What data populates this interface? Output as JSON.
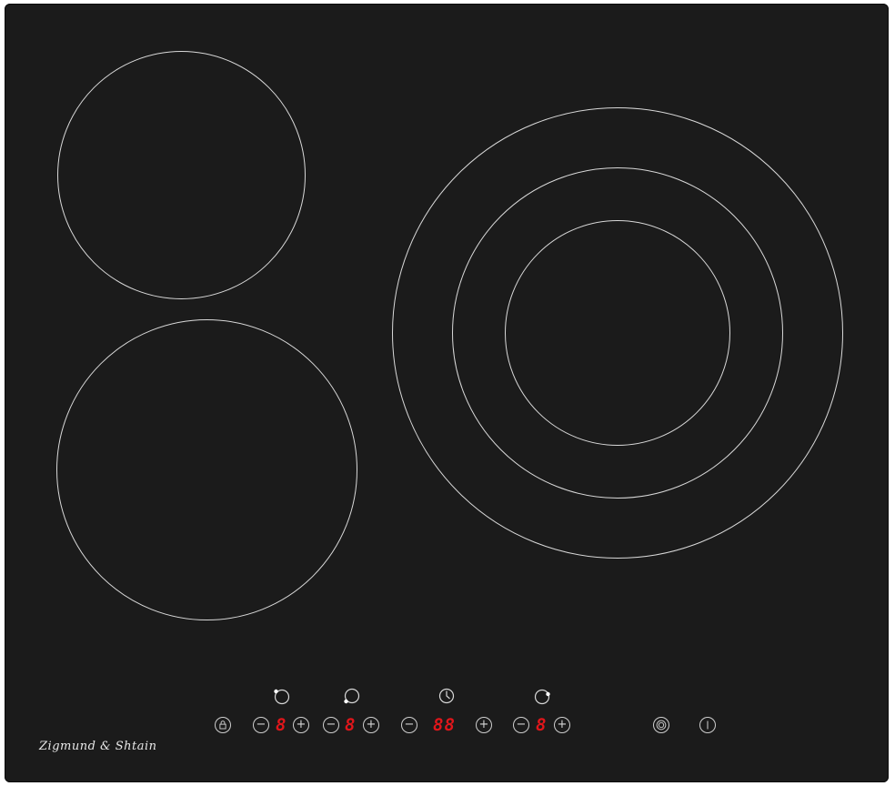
{
  "brand": {
    "name": "Zigmund & Shtain"
  },
  "controls": {
    "lock": {
      "icon": "lock-icon"
    },
    "zone_front_left": {
      "icon": "zone-front-left-icon",
      "minus": "−",
      "level": "8",
      "plus": "+"
    },
    "zone_rear_left": {
      "icon": "zone-rear-left-icon",
      "minus": "−",
      "level": "8",
      "plus": "+"
    },
    "timer": {
      "icon": "clock-icon",
      "minus": "−",
      "display": "88",
      "plus": "+"
    },
    "zone_right": {
      "icon": "zone-right-icon",
      "minus": "−",
      "level": "8",
      "plus": "+"
    },
    "dual_zone": {
      "icon": "dual-zone-icon"
    },
    "power": {
      "icon": "power-icon"
    }
  },
  "colors": {
    "glass": "#1b1b1b",
    "zone_outline": "#d9d9d9",
    "display_red": "#e0161b",
    "control_outline": "#cfcfcf"
  }
}
